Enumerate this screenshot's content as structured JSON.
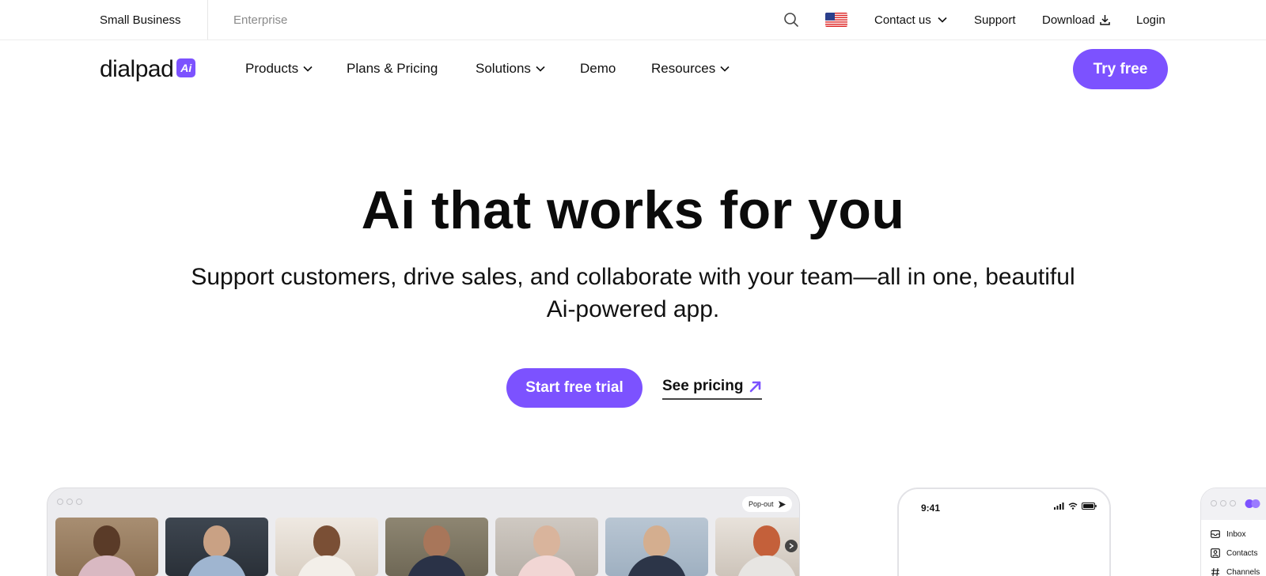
{
  "utility_bar": {
    "segments": [
      "Small Business",
      "Enterprise"
    ],
    "flag_icon": "us-flag-icon",
    "contact_label": "Contact us",
    "support_label": "Support",
    "download_label": "Download",
    "login_label": "Login"
  },
  "nav": {
    "logo_text": "dialpad",
    "logo_badge": "Ai",
    "items": [
      "Products",
      "Plans & Pricing",
      "Solutions",
      "Demo",
      "Resources"
    ],
    "cta_label": "Try free"
  },
  "hero": {
    "title": "Ai that works for you",
    "subtitle_line1": "Support customers, drive sales, and collaborate with your team—all in one, beautiful",
    "subtitle_line2": "Ai-powered app.",
    "primary_cta": "Start free trial",
    "secondary_cta": "See pricing"
  },
  "preview": {
    "popout_label": "Pop-out",
    "phone_time": "9:41",
    "sidebar_items": [
      "Inbox",
      "Contacts",
      "Channels"
    ]
  },
  "colors": {
    "brand_purple": "#7c52ff",
    "text_dark": "#111111",
    "muted_gray": "#8a8a8a"
  }
}
